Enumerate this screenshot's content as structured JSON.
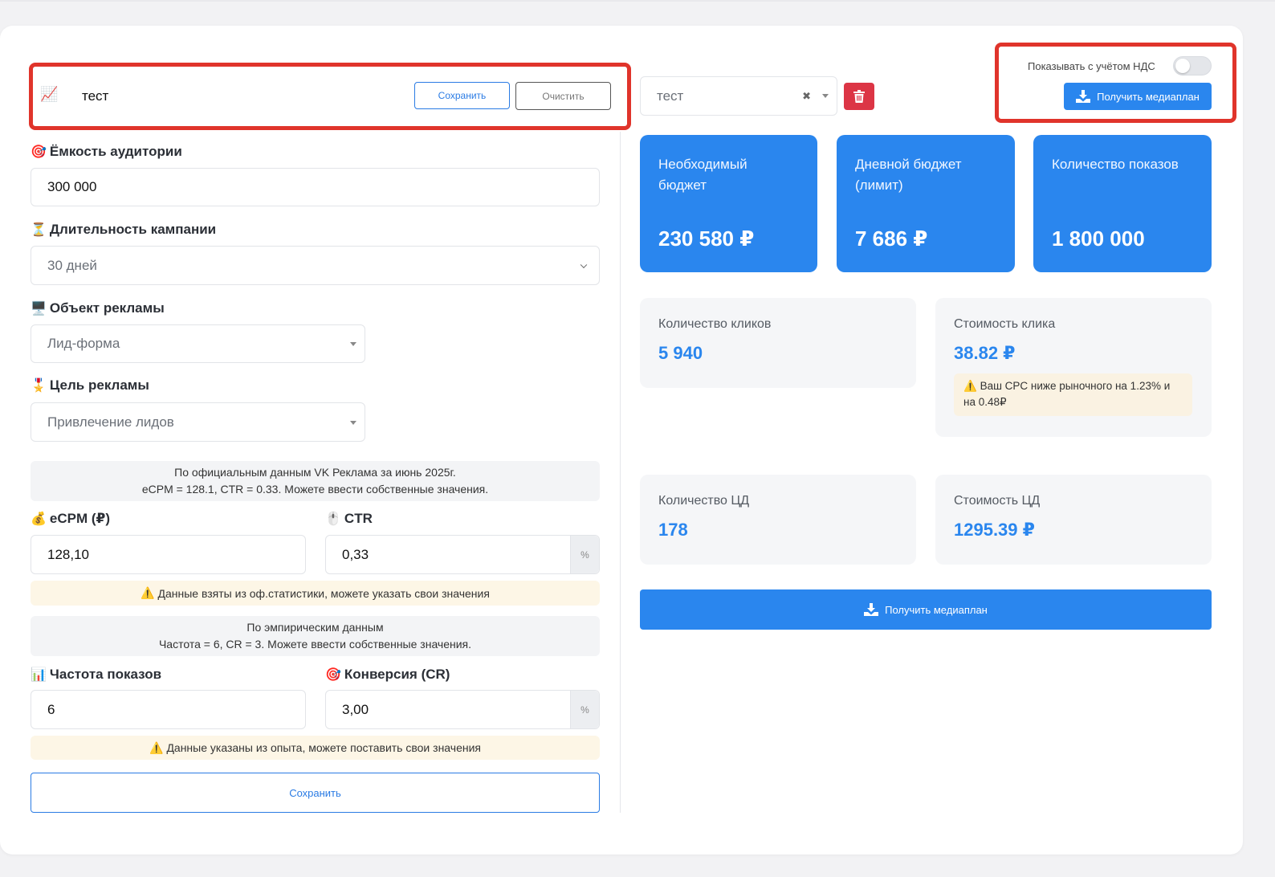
{
  "plan": {
    "icon": "📈",
    "name": "тест",
    "save_label": "Сохранить",
    "clear_label": "Очистить"
  },
  "selector": {
    "value": "тест",
    "clear_symbol": "✖"
  },
  "vat": {
    "label": "Показывать с учётом НДС",
    "enabled": false
  },
  "actions": {
    "get_mediaplan_label": "Получить медиаплан"
  },
  "form": {
    "audience": {
      "emoji": "🎯",
      "label": "Ёмкость аудитории",
      "value": "300 000"
    },
    "duration": {
      "emoji": "⏳",
      "label": "Длительность кампании",
      "value": "30 дней"
    },
    "ad_object": {
      "emoji": "🖥️",
      "label": "Объект рекламы",
      "value": "Лид-форма"
    },
    "ad_goal": {
      "emoji": "🎖️",
      "label": "Цель рекламы",
      "value": "Привлечение лидов"
    },
    "official_info": {
      "line1": "По официальным данным VK Реклама за июнь 2025г.",
      "line2": "eCPM = 128.1, CTR = 0.33. Можете ввести собственные значения."
    },
    "ecpm": {
      "emoji": "💰",
      "label": "eCPM (₽)",
      "value": "128,10"
    },
    "ctr": {
      "emoji": "🖱️",
      "label": "CTR",
      "value": "0,33",
      "unit": "%"
    },
    "official_warning": {
      "icon": "⚠️",
      "text": "Данные взяты из оф.статистики, можете указать свои значения"
    },
    "empirical_info": {
      "line1": "По эмпирическим данным",
      "line2": "Частота = 6, CR = 3. Можете ввести собственные значения."
    },
    "frequency": {
      "emoji": "📊",
      "label": "Частота показов",
      "value": "6"
    },
    "cr": {
      "emoji": "🎯",
      "label": "Конверсия (CR)",
      "value": "3,00",
      "unit": "%"
    },
    "empirical_warning": {
      "icon": "⚠️",
      "text": "Данные указаны из опыта, можете поставить свои значения"
    },
    "save_label": "Сохранить"
  },
  "metrics": {
    "budget": {
      "label": "Необходимый бюджет",
      "value": "230 580 ₽"
    },
    "daily_budget": {
      "label": "Дневной бюджет (лимит)",
      "value": "7 686 ₽"
    },
    "impressions": {
      "label": "Количество показов",
      "value": "1 800 000"
    },
    "clicks": {
      "label": "Количество кликов",
      "value": "5 940"
    },
    "cpc": {
      "label": "Стоимость клика",
      "value": "38.82 ₽"
    },
    "cpc_note": {
      "icon": "⚠️",
      "text": "Ваш CPC ниже рыночного на 1.23% и на 0.48₽"
    },
    "conversions": {
      "label": "Количество ЦД",
      "value": "178"
    },
    "cost_per_conversion": {
      "label": "Стоимость ЦД",
      "value": "1295.39 ₽"
    }
  },
  "colors": {
    "accent": "#2a86ee",
    "highlight": "#e0342b",
    "danger": "#dc3545",
    "warning_bg": "#fdf6e6"
  },
  "icons": {
    "download": "download-icon",
    "trash": "trash-icon"
  }
}
